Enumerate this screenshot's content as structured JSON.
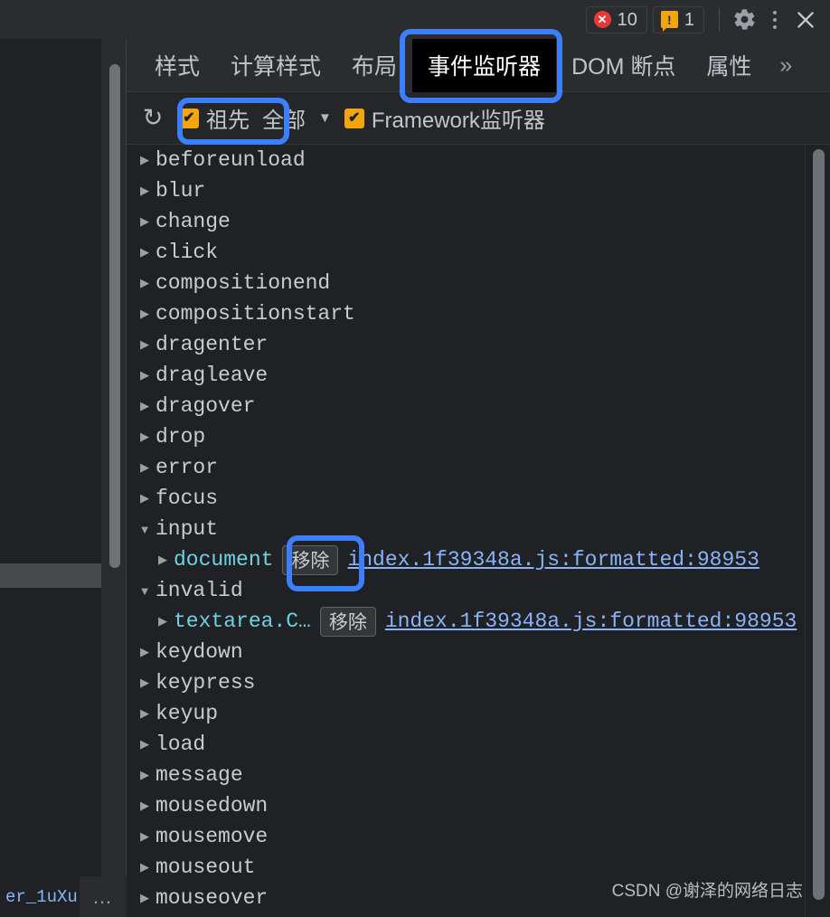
{
  "topbar": {
    "error_badge": {
      "icon": "error-circle-icon",
      "glyph": "✕",
      "count": "10",
      "color": "#e53935"
    },
    "warning_badge": {
      "icon": "warning-triangle-icon",
      "glyph": "!",
      "count": "1",
      "color": "#f2a50c"
    },
    "settings_icon": "gear-icon",
    "settings_glyph": "⚙",
    "more_icon": "three-dots-vertical-icon",
    "close_icon": "close-icon",
    "close_glyph": "✕"
  },
  "tabs": [
    {
      "label": "样式",
      "name": "tab-styles",
      "highlighted": false
    },
    {
      "label": "计算样式",
      "name": "tab-computed",
      "highlighted": false
    },
    {
      "label": "布局",
      "name": "tab-layout",
      "highlighted": false
    },
    {
      "label": "事件监听器",
      "name": "tab-event-listeners",
      "highlighted": true
    },
    {
      "label": "DOM 断点",
      "name": "tab-dom-breakpoints",
      "highlighted": false
    },
    {
      "label": "属性",
      "name": "tab-properties",
      "highlighted": false
    }
  ],
  "tabs_overflow_glyph": "»",
  "toolbar": {
    "refresh_glyph": "↻",
    "ancestors_checkbox": {
      "label": "祖先",
      "checked": true,
      "check_glyph": "✔"
    },
    "filter_dropdown": {
      "value": "全部",
      "caret_glyph": "▼"
    },
    "framework_checkbox": {
      "label": "Framework监听器",
      "checked": true,
      "check_glyph": "✔"
    }
  },
  "events": [
    {
      "name": "beforeunload",
      "expanded": false,
      "children": []
    },
    {
      "name": "blur",
      "expanded": false,
      "children": []
    },
    {
      "name": "change",
      "expanded": false,
      "children": []
    },
    {
      "name": "click",
      "expanded": false,
      "children": []
    },
    {
      "name": "compositionend",
      "expanded": false,
      "children": []
    },
    {
      "name": "compositionstart",
      "expanded": false,
      "children": []
    },
    {
      "name": "dragenter",
      "expanded": false,
      "children": []
    },
    {
      "name": "dragleave",
      "expanded": false,
      "children": []
    },
    {
      "name": "dragover",
      "expanded": false,
      "children": []
    },
    {
      "name": "drop",
      "expanded": false,
      "children": []
    },
    {
      "name": "error",
      "expanded": false,
      "children": []
    },
    {
      "name": "focus",
      "expanded": false,
      "children": []
    },
    {
      "name": "input",
      "expanded": true,
      "children": [
        {
          "node": "document",
          "remove_label": "移除",
          "source": "index.1f39348a.js:formatted:98953",
          "highlighted": true
        }
      ]
    },
    {
      "name": "invalid",
      "expanded": true,
      "children": [
        {
          "node": "textarea.C…",
          "remove_label": "移除",
          "source": "index.1f39348a.js:formatted:98953",
          "highlighted": false
        }
      ]
    },
    {
      "name": "keydown",
      "expanded": false,
      "children": []
    },
    {
      "name": "keypress",
      "expanded": false,
      "children": []
    },
    {
      "name": "keyup",
      "expanded": false,
      "children": []
    },
    {
      "name": "load",
      "expanded": false,
      "children": []
    },
    {
      "name": "message",
      "expanded": false,
      "children": []
    },
    {
      "name": "mousedown",
      "expanded": false,
      "children": []
    },
    {
      "name": "mousemove",
      "expanded": false,
      "children": []
    },
    {
      "name": "mouseout",
      "expanded": false,
      "children": []
    },
    {
      "name": "mouseover",
      "expanded": false,
      "children": []
    }
  ],
  "tree_glyphs": {
    "collapsed": "▶",
    "expanded": "▼"
  },
  "left_panel": {
    "breadcrumb_text": "er_1uXu",
    "breadcrumb_more": "…"
  },
  "watermark": "CSDN @谢泽的网络日志",
  "colors": {
    "highlight_box": "#3d7ffb",
    "checkbox_accent": "#f2a50c",
    "link": "#8ab4f8",
    "node_name": "#6fd2e2",
    "error": "#e53935",
    "warning": "#f2a50c",
    "panel_bg": "#202124",
    "bar_bg": "#2b2c30"
  }
}
